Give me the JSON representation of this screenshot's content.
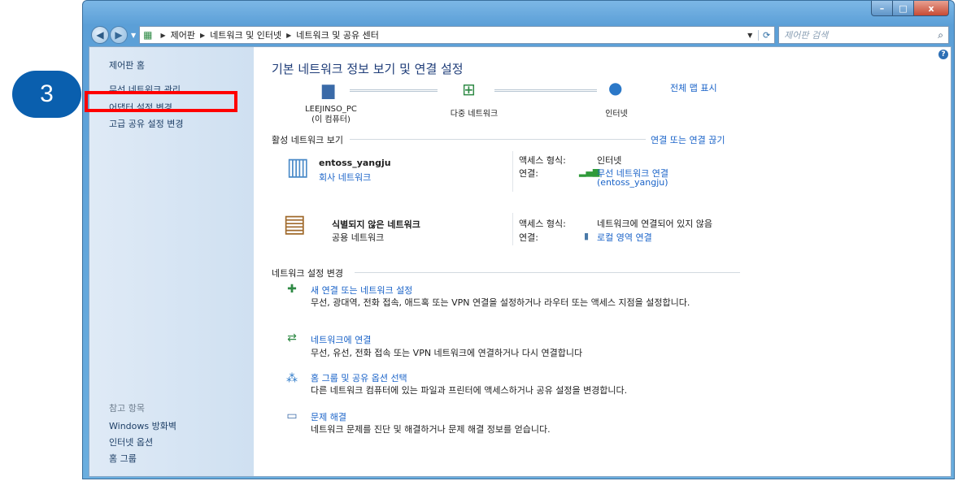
{
  "annotation": {
    "step_number": "3"
  },
  "window": {
    "controls": {
      "minimize": "–",
      "maximize": "□",
      "close": "x"
    }
  },
  "address_bar": {
    "breadcrumbs": [
      "제어판",
      "네트워크 및 인터넷",
      "네트워크 및 공유 센터"
    ],
    "search_placeholder": "제어판 검색"
  },
  "sidebar": {
    "items": [
      {
        "label": "제어판 홈"
      },
      {
        "label": "무선 네트워크 관리"
      },
      {
        "label": "어댑터 설정 변경"
      },
      {
        "label": "고급 공유 설정 변경"
      }
    ],
    "see_also_heading": "참고 항목",
    "see_also": [
      {
        "label": "Windows 방화벽"
      },
      {
        "label": "인터넷 옵션"
      },
      {
        "label": "홈 그룹"
      }
    ]
  },
  "main": {
    "title": "기본 네트워크 정보 보기 및 연결 설정",
    "full_map_link": "전체 맵 표시",
    "map_nodes": [
      {
        "label_line1": "LEEJINSO_PC",
        "label_line2": "(이 컴퓨터)",
        "icon": "computer-icon"
      },
      {
        "label_line1": "다중 네트워크",
        "label_line2": "",
        "icon": "network-icon"
      },
      {
        "label_line1": "인터넷",
        "label_line2": "",
        "icon": "globe-icon"
      }
    ],
    "active_networks_heading": "활성 네트워크 보기",
    "connect_disconnect_link": "연결 또는 연결 끊기",
    "networks": [
      {
        "name": "entoss_yangju",
        "type": "회사 네트워크",
        "access_type_label": "액세스 형식:",
        "access_type_value": "인터넷",
        "connection_label": "연결:",
        "connection_value_line1": "무선 네트워크 연결",
        "connection_value_line2": "(entoss_yangju)"
      },
      {
        "name": "식별되지 않은 네트워크",
        "type": "공용 네트워크",
        "access_type_label": "액세스 형식:",
        "access_type_value": "네트워크에 연결되어 있지 않음",
        "connection_label": "연결:",
        "connection_value_line1": "로컬 영역 연결",
        "connection_value_line2": ""
      }
    ],
    "settings_heading": "네트워크 설정 변경",
    "tasks": [
      {
        "title": "새 연결 또는 네트워크 설정",
        "description": "무선, 광대역, 전화 접속, 애드혹 또는 VPN 연결을 설정하거나 라우터 또는 액세스 지점을 설정합니다."
      },
      {
        "title": "네트워크에 연결",
        "description": "무선, 유선, 전화 접속 또는 VPN 네트워크에 연결하거나 다시 연결합니다"
      },
      {
        "title": "홈 그룹 및 공유 옵션 선택",
        "description": "다른 네트워크 컴퓨터에 있는 파일과 프린터에 액세스하거나 공유 설정을 변경합니다."
      },
      {
        "title": "문제 해결",
        "description": "네트워크 문제를 진단 및 해결하거나 문제 해결 정보를 얻습니다."
      }
    ]
  }
}
